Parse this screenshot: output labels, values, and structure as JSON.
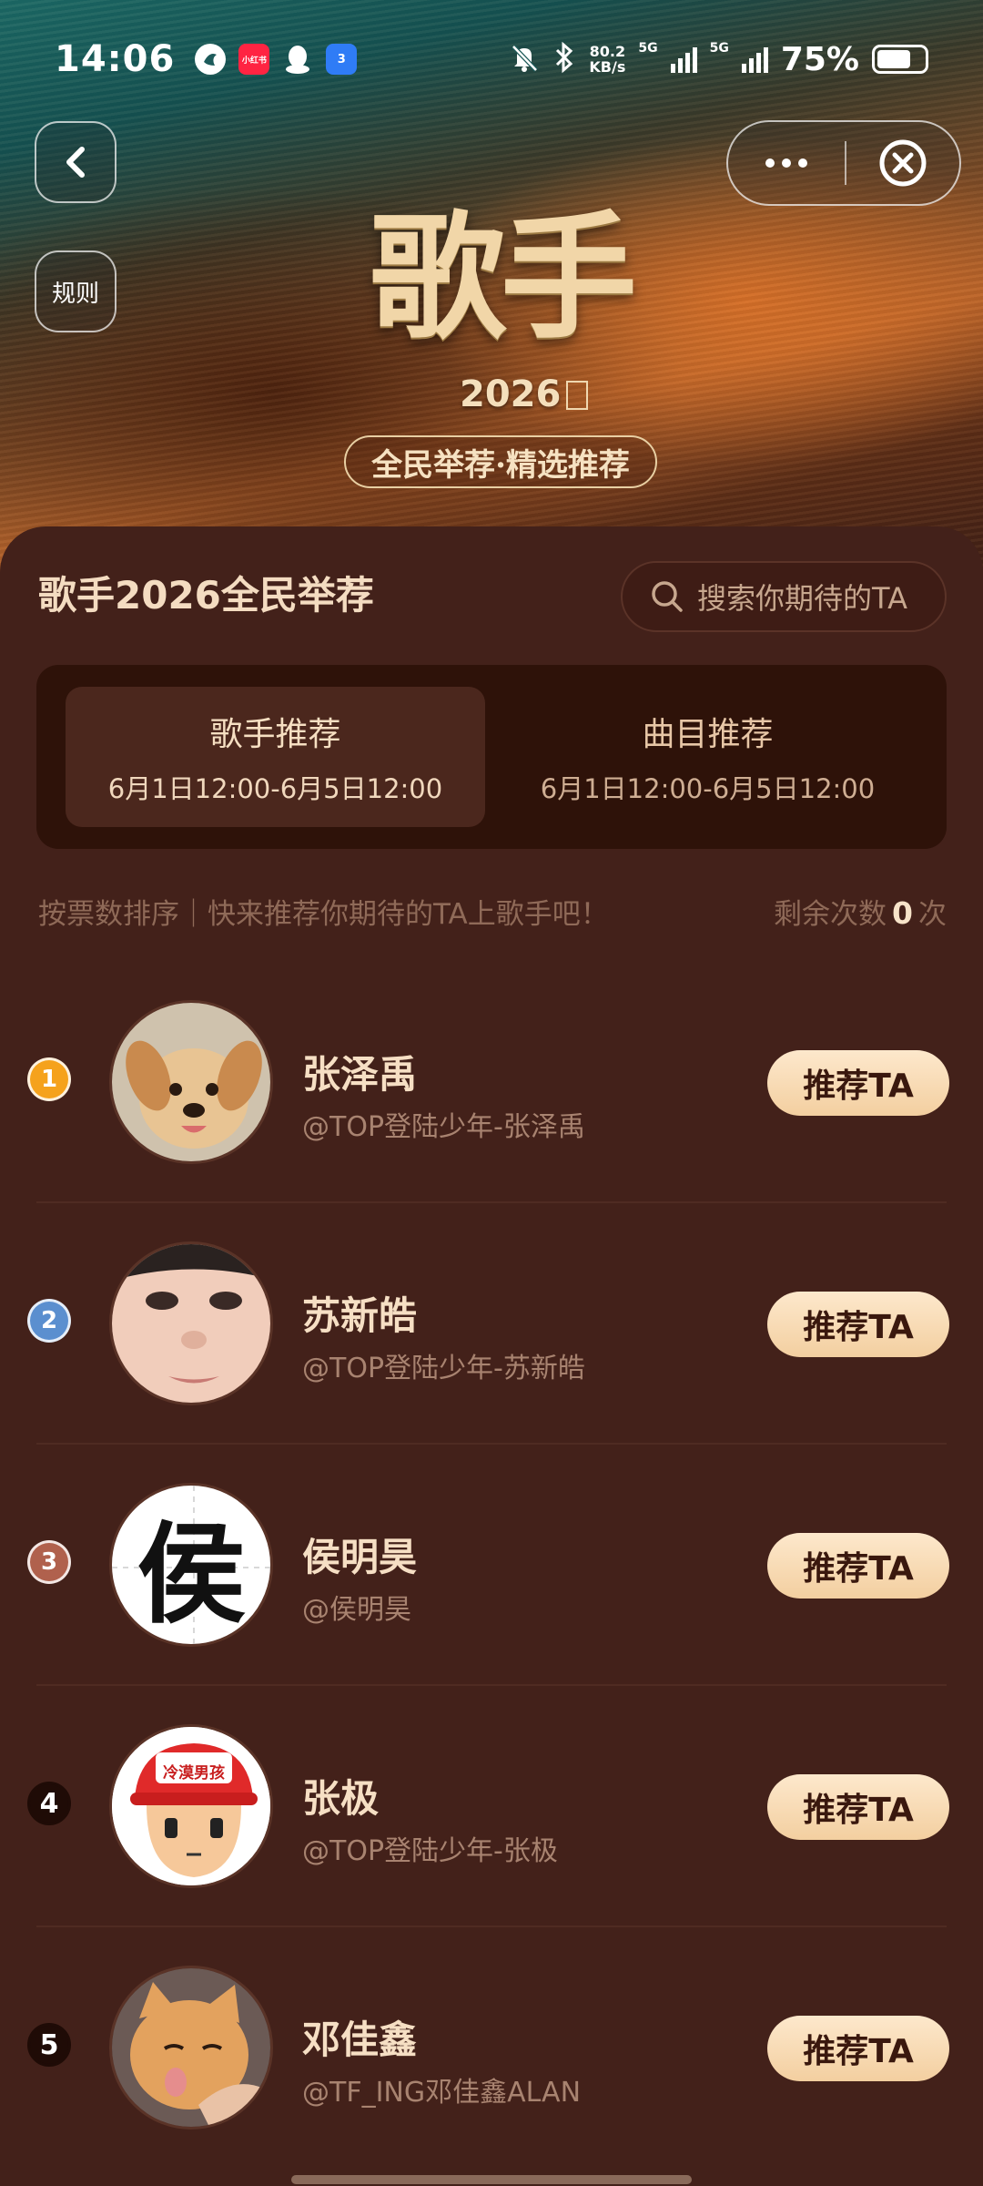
{
  "status_bar": {
    "time": "14:06",
    "app_xiaohongshu": "小红书",
    "app_badge_count": "3",
    "net_speed_top": "80.2",
    "net_speed_bottom": "KB/s",
    "sim1": "5G",
    "sim2": "5G",
    "battery_text": "75%",
    "battery_level": 0.75
  },
  "nav": {
    "rules_label": "规则"
  },
  "banner": {
    "title": "歌手",
    "year": "2026",
    "subtitle": "全民举荐·精选推荐"
  },
  "page": {
    "title": "歌手2026全民举荐",
    "search_placeholder": "搜索你期待的TA"
  },
  "tabs": [
    {
      "name": "歌手推荐",
      "time": "6月1日12:00-6月5日12:00",
      "active": true
    },
    {
      "name": "曲目推荐",
      "time": "6月1日12:00-6月5日12:00",
      "active": false
    }
  ],
  "sort": {
    "left_text": "按票数排序｜快来推荐你期待的TA上歌手吧！",
    "remain_prefix": "剩余次数",
    "remain_count": "0",
    "remain_suffix": "次"
  },
  "candidates": [
    {
      "rank": "1",
      "name": "张泽禹",
      "handle": "@TOP登陆少年-张泽禹",
      "button": "推荐TA",
      "rank_color": "#f5a21c"
    },
    {
      "rank": "2",
      "name": "苏新皓",
      "handle": "@TOP登陆少年-苏新皓",
      "button": "推荐TA",
      "rank_color": "#5b8fcf"
    },
    {
      "rank": "3",
      "name": "侯明昊",
      "handle": "@侯明昊",
      "button": "推荐TA",
      "rank_color": "#b0614d",
      "avatar_char": "侯"
    },
    {
      "rank": "4",
      "name": "张极",
      "handle": "@TOP登陆少年-张极",
      "button": "推荐TA",
      "avatar_cap_text": "冷漠男孩"
    },
    {
      "rank": "5",
      "name": "邓佳鑫",
      "handle": "@TF_ING邓佳鑫ALAN",
      "button": "推荐TA"
    }
  ]
}
